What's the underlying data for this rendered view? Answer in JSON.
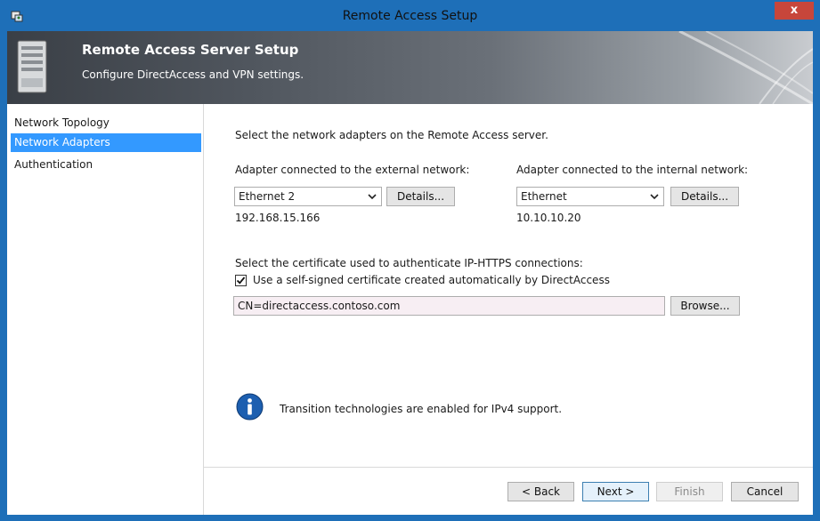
{
  "window": {
    "title": "Remote Access Setup",
    "close_label": "x"
  },
  "header": {
    "title": "Remote Access Server Setup",
    "subtitle": "Configure DirectAccess and VPN settings."
  },
  "nav": {
    "items": [
      {
        "label": "Network Topology",
        "selected": false
      },
      {
        "label": "Network Adapters",
        "selected": true
      },
      {
        "label": "Authentication",
        "selected": false
      }
    ]
  },
  "content": {
    "intro": "Select the network adapters on the Remote Access server.",
    "external": {
      "label": "Adapter connected to the external network:",
      "value": "Ethernet 2",
      "details_label": "Details...",
      "ip": "192.168.15.166"
    },
    "internal": {
      "label": "Adapter connected to the internal network:",
      "value": "Ethernet",
      "details_label": "Details...",
      "ip": "10.10.10.20"
    },
    "cert": {
      "label": "Select the certificate used to authenticate IP-HTTPS connections:",
      "checkbox_label": "Use a self-signed certificate created automatically by DirectAccess",
      "checked": true,
      "value": "CN=directaccess.contoso.com",
      "browse_label": "Browse..."
    },
    "info": "Transition technologies are enabled for IPv4 support."
  },
  "footer": {
    "back_label": "< Back",
    "next_label": "Next >",
    "finish_label": "Finish",
    "cancel_label": "Cancel"
  },
  "colors": {
    "titlebar": "#1e6fb8",
    "selection": "#3399ff",
    "close": "#c7463b"
  }
}
